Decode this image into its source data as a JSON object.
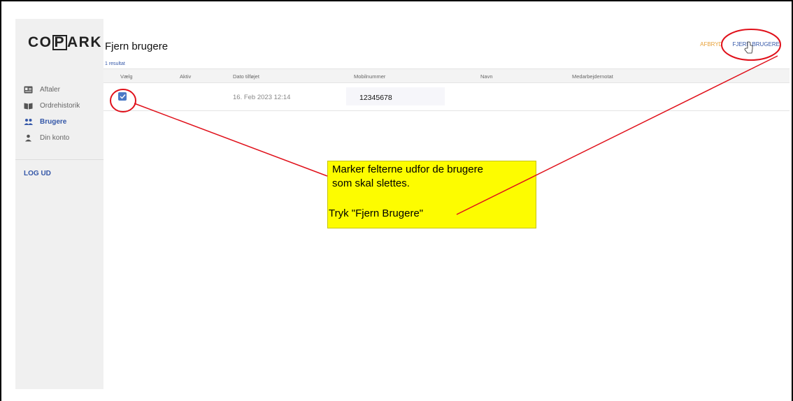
{
  "sidebar": {
    "logo": {
      "prefix": "CO",
      "boxed": "P",
      "suffix": "ARK"
    },
    "items": [
      {
        "label": "Aftaler",
        "icon": "contact-card-icon",
        "active": false
      },
      {
        "label": "Ordrehistorik",
        "icon": "open-book-icon",
        "active": false
      },
      {
        "label": "Brugere",
        "icon": "users-icon",
        "active": true
      },
      {
        "label": "Din konto",
        "icon": "person-icon",
        "active": false
      }
    ],
    "logout_label": "LOG UD"
  },
  "header": {
    "title": "Fjern brugere",
    "cancel_label": "AFBRYD",
    "remove_label": "FJERN BRUGERE"
  },
  "table": {
    "result_count": "1 resultat",
    "columns": [
      "Vælg",
      "Aktiv",
      "Dato tilføjet",
      "Mobilnummer",
      "Navn",
      "Medarbejdernotat"
    ],
    "rows": [
      {
        "selected": true,
        "active": "",
        "date_added": "16. Feb 2023 12:14",
        "mobile": "12345678",
        "name": "",
        "note": ""
      }
    ]
  },
  "annotation": {
    "line1": "Marker felterne udfor de brugere",
    "line2": "som skal slettes.",
    "line3": "Tryk \"Fjern Brugere\""
  },
  "colors": {
    "accent": "#3457a8",
    "cancel": "#e8a23a",
    "checkbox": "#4a78c6",
    "annotation_bg": "#fdfc00",
    "annotation_marks": "#e0101a"
  }
}
